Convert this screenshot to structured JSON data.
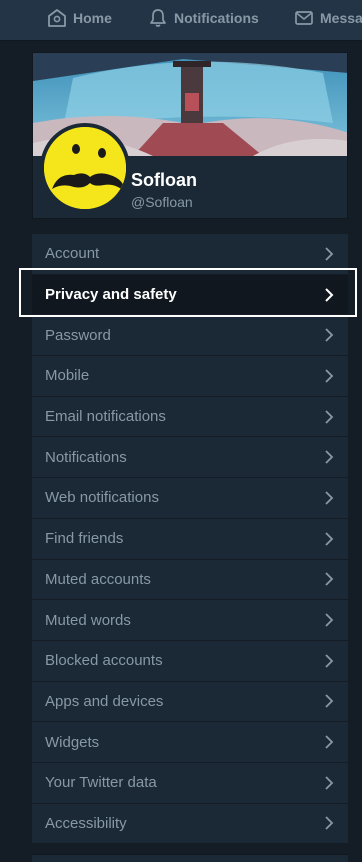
{
  "topnav": {
    "home_label": "Home",
    "notifications_label": "Notifications",
    "messages_label": "Messa",
    "home_icon": "home-icon",
    "notifications_icon": "bell-icon",
    "messages_icon": "envelope-icon"
  },
  "profile": {
    "display_name": "Sofloan",
    "handle": "@Sofloan"
  },
  "settings_menu": {
    "items": [
      {
        "label": "Account"
      },
      {
        "label": "Privacy and safety"
      },
      {
        "label": "Password"
      },
      {
        "label": "Mobile"
      },
      {
        "label": "Email notifications"
      },
      {
        "label": "Notifications"
      },
      {
        "label": "Web notifications"
      },
      {
        "label": "Find friends"
      },
      {
        "label": "Muted accounts"
      },
      {
        "label": "Muted words"
      },
      {
        "label": "Blocked accounts"
      },
      {
        "label": "Apps and devices"
      },
      {
        "label": "Widgets"
      },
      {
        "label": "Your Twitter data"
      },
      {
        "label": "Accessibility"
      }
    ],
    "active_item": "Privacy and safety"
  },
  "colors": {
    "background": "#141d26",
    "panel": "#1b2836",
    "topbar": "#243447",
    "text_muted": "#8899a6",
    "text_active": "#ffffff"
  }
}
